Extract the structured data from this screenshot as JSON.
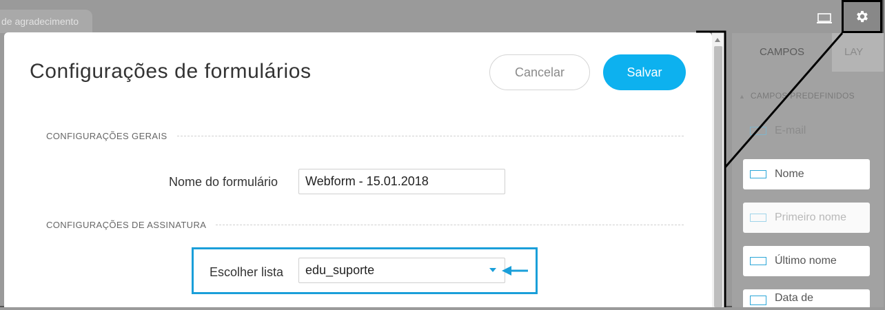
{
  "top_tab": {
    "label": "de agradecimento"
  },
  "toolbar": {
    "laptop_icon": "laptop-icon",
    "gear_icon": "gear-icon"
  },
  "modal": {
    "title": "Configurações de formulários",
    "cancel_label": "Cancelar",
    "save_label": "Salvar",
    "general_section": "CONFIGURAÇÕES GERAIS",
    "form_name_label": "Nome do formulário",
    "form_name_value": "Webform - 15.01.2018",
    "subscription_section": "CONFIGURAÇÕES DE ASSINATURA",
    "list_label": "Escolher lista",
    "list_value": "edu_suporte"
  },
  "right_panel": {
    "tabs": [
      "CAMPOS",
      "LAY"
    ],
    "section": "CAMPOS PREDEFINIDOS",
    "items": [
      {
        "label": "E-mail",
        "icon": "text-field-icon"
      },
      {
        "label": "Nome",
        "icon": "text-field-icon"
      },
      {
        "label": "Primeiro nome",
        "icon": "text-field-icon"
      },
      {
        "label": "Último nome",
        "icon": "text-field-icon"
      },
      {
        "label": "Data de",
        "icon": "calendar-icon"
      }
    ]
  },
  "colors": {
    "accent": "#0db1ef",
    "highlight": "#1a9fd9"
  }
}
